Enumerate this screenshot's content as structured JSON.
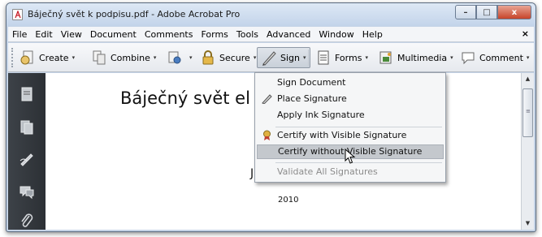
{
  "window": {
    "title": "Báječný svět k podpisu.pdf - Adobe Acrobat Pro",
    "controls": {
      "minimize": "–",
      "maximize": "□",
      "close": "x"
    }
  },
  "menubar": {
    "items": [
      "File",
      "Edit",
      "View",
      "Document",
      "Comments",
      "Forms",
      "Tools",
      "Advanced",
      "Window",
      "Help"
    ],
    "close_glyph": "×"
  },
  "toolbar": {
    "create": "Create",
    "combine": "Combine",
    "secure": "Secure",
    "sign": "Sign",
    "forms": "Forms",
    "multimedia": "Multimedia",
    "comment": "Comment",
    "arrow": "▾"
  },
  "leftnav": {
    "icons": [
      "pages-icon",
      "attachments-icon",
      "signatures-icon",
      "comments-icon",
      "paperclip-icon"
    ]
  },
  "document": {
    "title": "Báječný svět el",
    "letter": "J",
    "year": "2010"
  },
  "sign_menu": {
    "items": [
      {
        "label": "Sign Document",
        "state": "enabled"
      },
      {
        "label": "Place Signature",
        "state": "enabled",
        "icon": "pen-icon"
      },
      {
        "label": "Apply Ink Signature",
        "state": "enabled"
      },
      {
        "label": "Certify with Visible Signature",
        "state": "enabled",
        "icon": "ribbon-icon"
      },
      {
        "label": "Certify without Visible Signature",
        "state": "hovered"
      },
      {
        "label": "Validate All Signatures",
        "state": "disabled"
      }
    ]
  },
  "colors": {
    "titlebar": "#c3d4ea",
    "leftnav": "#35393e",
    "menu_highlight": "#c4c8cd"
  }
}
